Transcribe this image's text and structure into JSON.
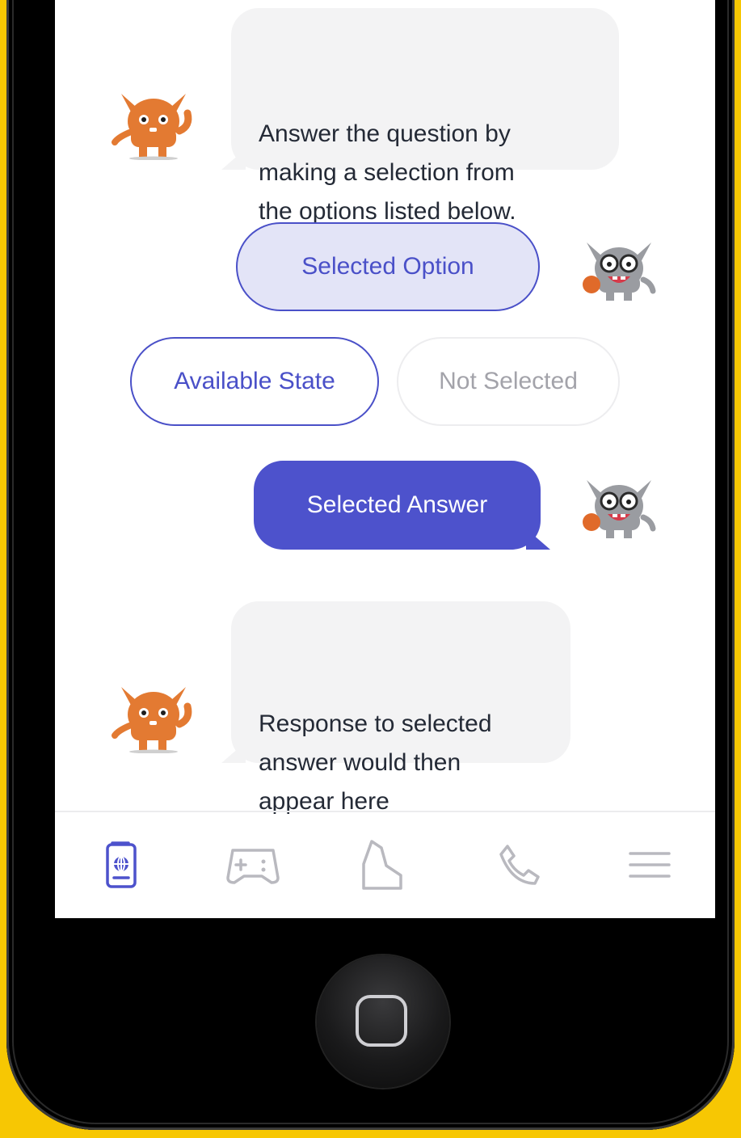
{
  "chat": {
    "bot_message_1": "Answer the question by\nmaking a selection from\nthe options listed below.",
    "selected_option": "Selected Option",
    "available_state": "Available State",
    "not_selected": "Not Selected",
    "selected_answer": "Selected Answer",
    "bot_message_2": "Response to selected\nanswer would then\nappear here"
  },
  "nav": {
    "items": [
      {
        "icon": "passport-icon",
        "active": true
      },
      {
        "icon": "gamepad-icon",
        "active": false
      },
      {
        "icon": "map-region-icon",
        "active": false
      },
      {
        "icon": "phone-icon",
        "active": false
      },
      {
        "icon": "menu-icon",
        "active": false
      }
    ]
  },
  "colors": {
    "accent": "#4d52cc",
    "selected_fill": "#e3e4f7",
    "bubble_gray": "#f3f3f4",
    "frame_yellow": "#f7c703"
  }
}
